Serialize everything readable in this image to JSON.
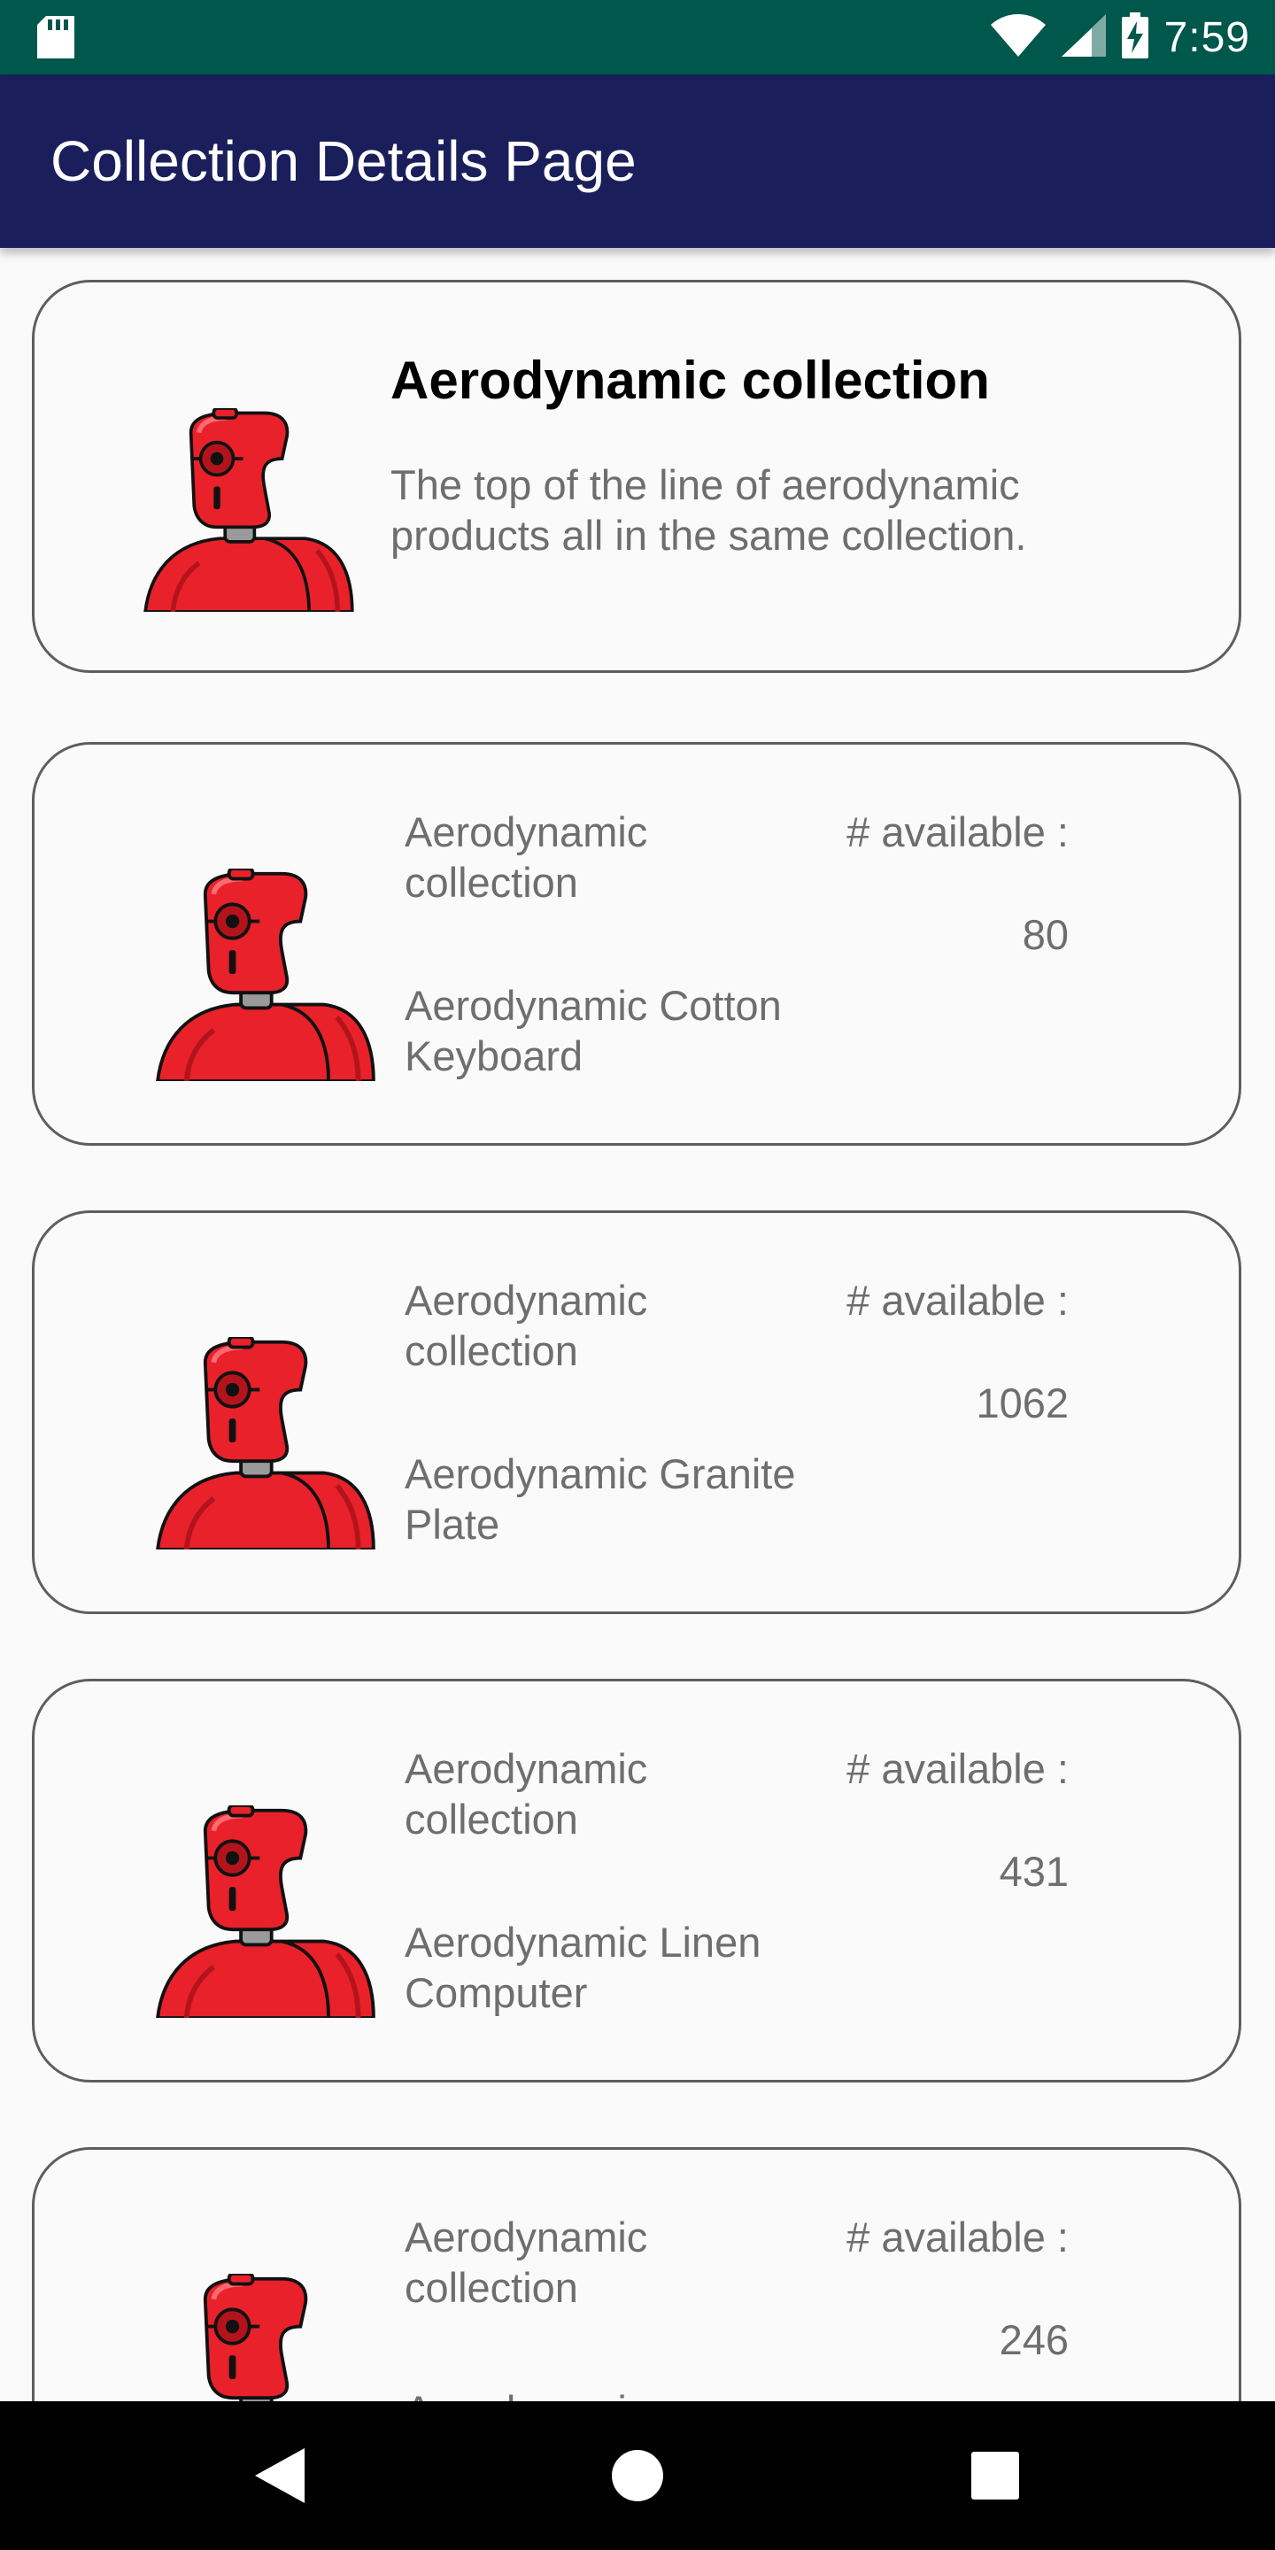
{
  "status_bar": {
    "time": "7:59",
    "icons": [
      "sd-card-icon",
      "wifi-icon",
      "signal-icon",
      "battery-charging-icon"
    ]
  },
  "app_bar": {
    "title": "Collection Details Page"
  },
  "collection": {
    "title": "Aerodynamic collection",
    "description": "The top of the line of aerodynamic products all in the same collection."
  },
  "products": [
    {
      "collection": "Aerodynamic collection",
      "name": "Aerodynamic Cotton Keyboard",
      "available_label": "# available :",
      "available": "80"
    },
    {
      "collection": "Aerodynamic collection",
      "name": "Aerodynamic Granite Plate",
      "available_label": "# available :",
      "available": "1062"
    },
    {
      "collection": "Aerodynamic collection",
      "name": "Aerodynamic Linen Computer",
      "available_label": "# available :",
      "available": "431"
    },
    {
      "collection": "Aerodynamic collection",
      "name": "Aerodynamic",
      "available_label": "# available :",
      "available": "246"
    }
  ],
  "nav_bar": {
    "icons": [
      "back-icon",
      "home-icon",
      "recents-icon"
    ]
  },
  "colors": {
    "status_bar": "#00574B",
    "app_bar": "#1A1F5C",
    "robot": "#E8212B",
    "text_secondary": "#6E6E6E"
  }
}
